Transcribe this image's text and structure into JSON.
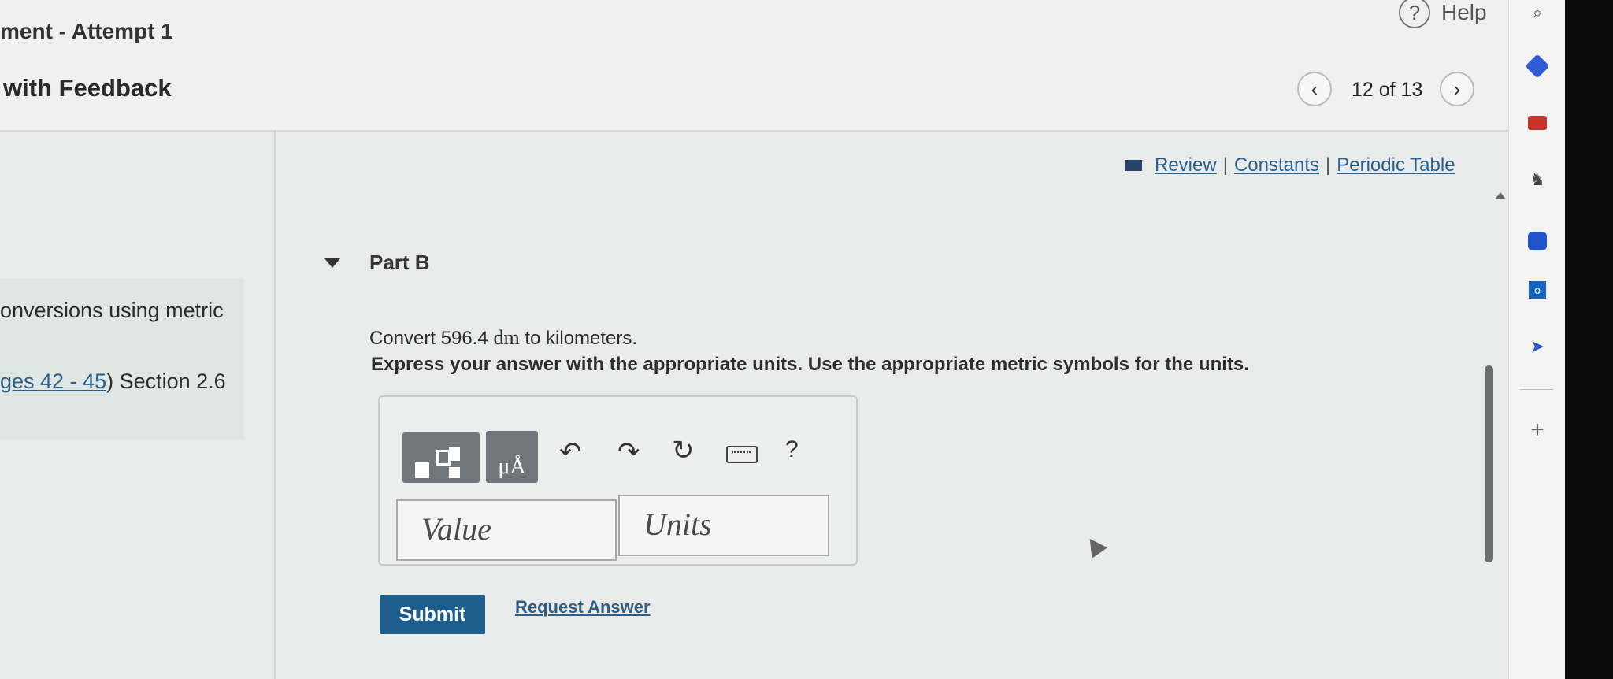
{
  "header": {
    "assignment_title": "ment - Attempt 1",
    "assignment_subtitle": "with Feedback",
    "help_label": "Help",
    "nav": {
      "prev_icon": "chevron-left",
      "next_icon": "chevron-right",
      "counter": "12 of 13"
    }
  },
  "left_panel": {
    "topic": "onversions using metric",
    "section_link": "ges 42 - 45",
    "section_rest": ") Section 2.6"
  },
  "resources": {
    "review": "Review",
    "constants": "Constants",
    "periodic_table": "Periodic Table",
    "separator": "|"
  },
  "part": {
    "title": "Part B",
    "question_prefix": "Convert 596.4 ",
    "question_unit": "dm",
    "question_suffix": " to kilometers.",
    "instruction": "Express your answer with the appropriate units. Use the appropriate metric symbols for the units."
  },
  "toolbar": {
    "units_label": "μÅ",
    "undo_glyph": "↶",
    "redo_glyph": "↷",
    "reset_glyph": "↻",
    "help_glyph": "?"
  },
  "answer": {
    "value_placeholder": "Value",
    "units_placeholder": "Units"
  },
  "actions": {
    "submit_label": "Submit",
    "request_answer_label": "Request Answer"
  },
  "sidebar": {
    "search_glyph": "⌕",
    "chess_glyph": "♞",
    "send_glyph": "➤",
    "add_glyph": "+",
    "outlook_glyph": "o"
  },
  "colors": {
    "accent": "#1e5e8c",
    "link": "#2a5f8b"
  }
}
